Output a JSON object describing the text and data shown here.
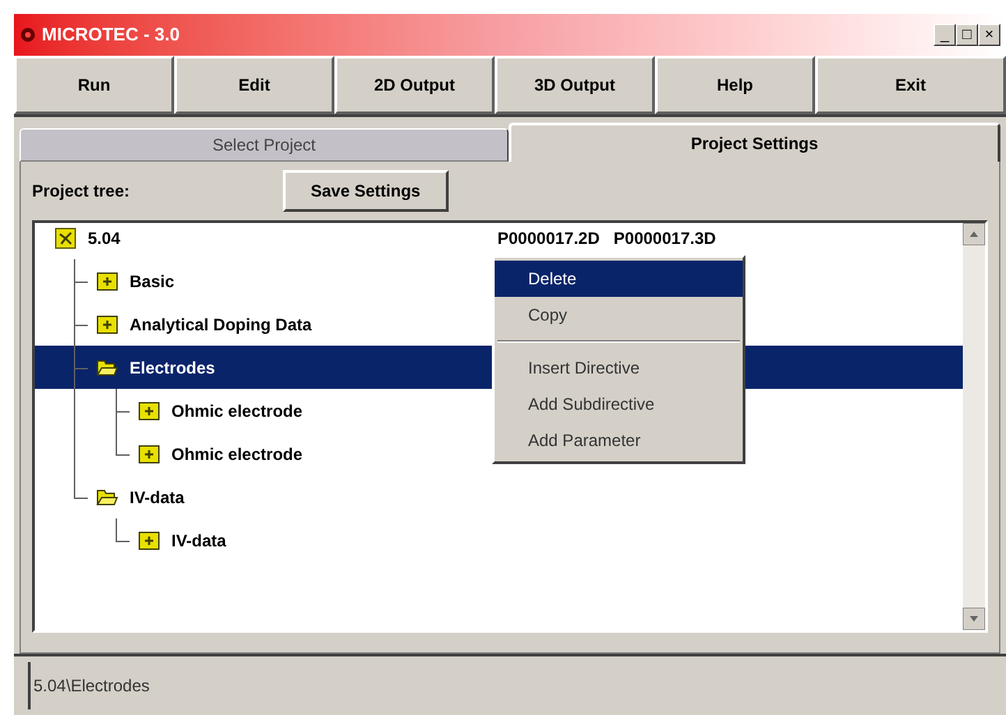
{
  "window": {
    "title": "MICROTEC - 3.0",
    "controls": [
      "_",
      "□",
      "×"
    ]
  },
  "toolbar": [
    "Run",
    "Edit",
    "2D Output",
    "3D Output",
    "Help",
    "Exit"
  ],
  "tabs": [
    {
      "label": "Select Project",
      "selected": false
    },
    {
      "label": "Project Settings",
      "selected": true
    }
  ],
  "project_tree_label": "Project tree:",
  "save_button": "Save Settings",
  "tree": {
    "label": "5.04",
    "expanded": true,
    "selected": false,
    "columns": [
      "P0000017.2D",
      "P0000017.3D"
    ],
    "children": [
      {
        "label": "Basic",
        "expanded": false,
        "selected": false
      },
      {
        "label": "Analytical Doping Data",
        "expanded": false,
        "selected": false
      },
      {
        "label": "Electrodes",
        "expanded": true,
        "selected": true,
        "children": [
          {
            "label": "Ohmic electrode",
            "expanded": false,
            "selected": false
          },
          {
            "label": "Ohmic electrode",
            "expanded": false,
            "selected": false
          }
        ]
      },
      {
        "label": "IV-data",
        "expanded": true,
        "selected": false,
        "children": [
          {
            "label": "IV-data",
            "expanded": false,
            "selected": false
          }
        ]
      }
    ]
  },
  "context_menu": {
    "groups": [
      [
        {
          "label": "Delete",
          "selected": true
        },
        {
          "label": "Copy",
          "selected": false
        }
      ],
      [
        {
          "label": "Insert Directive",
          "selected": false
        },
        {
          "label": "Add Subdirective",
          "selected": false
        },
        {
          "label": "Add Parameter",
          "selected": false
        }
      ]
    ]
  },
  "status_bar": "5.04\\Electrodes"
}
